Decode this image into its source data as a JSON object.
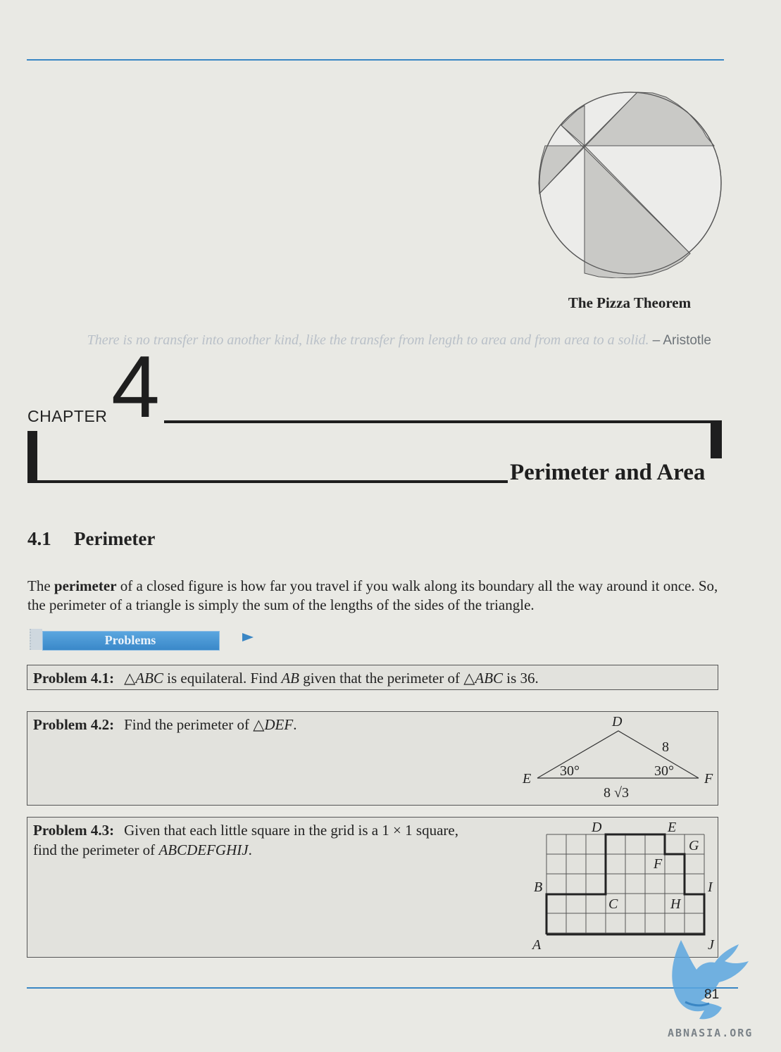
{
  "figure": {
    "caption": "The Pizza Theorem"
  },
  "epigraph": {
    "quote": "There is no transfer into another kind, like the transfer from length to area and from area to a solid.",
    "author": "– Aristotle"
  },
  "chapter": {
    "word": "CHAPTER",
    "number": "4",
    "title": "Perimeter and Area"
  },
  "section": {
    "number": "4.1",
    "title": "Perimeter"
  },
  "intro": {
    "before": "The ",
    "term": "perimeter",
    "after": " of a closed figure is how far you travel if you walk along its boundary all the way around it once. So, the perimeter of a triangle is simply the sum of the lengths of the sides of the triangle."
  },
  "problems_banner": {
    "label": "Problems"
  },
  "problems": [
    {
      "label": "Problem 4.1:",
      "text_1": "△",
      "var_1": "ABC",
      "text_2": " is equilateral. Find ",
      "var_2": "AB",
      "text_3": " given that the perimeter of △",
      "var_3": "ABC",
      "text_4": " is 36."
    },
    {
      "label": "Problem 4.2:",
      "text_1": "Find the perimeter of △",
      "var_1": "DEF",
      "text_2": ".",
      "figure": {
        "vertex_d": "D",
        "vertex_e": "E",
        "vertex_f": "F",
        "side_df": "8",
        "angle_e": "30°",
        "angle_f": "30°",
        "side_ef": "8 √3"
      }
    },
    {
      "label": "Problem 4.3:",
      "text_1": "Given that each little square in the grid is a 1 × 1 square,",
      "text_2": "find the perimeter of ",
      "var_1": "ABCDEFGHIJ",
      "text_3": ".",
      "figure": {
        "labels": [
          "A",
          "B",
          "C",
          "D",
          "E",
          "F",
          "G",
          "H",
          "I",
          "J"
        ]
      }
    }
  ],
  "watermark": {
    "text": "ABNASIA.ORG"
  },
  "page": {
    "number": "81"
  },
  "colors": {
    "accent_rule": "#3a86c4",
    "pizza_shade": "#c9c9c6",
    "banner_blue": "#3a88c9"
  }
}
